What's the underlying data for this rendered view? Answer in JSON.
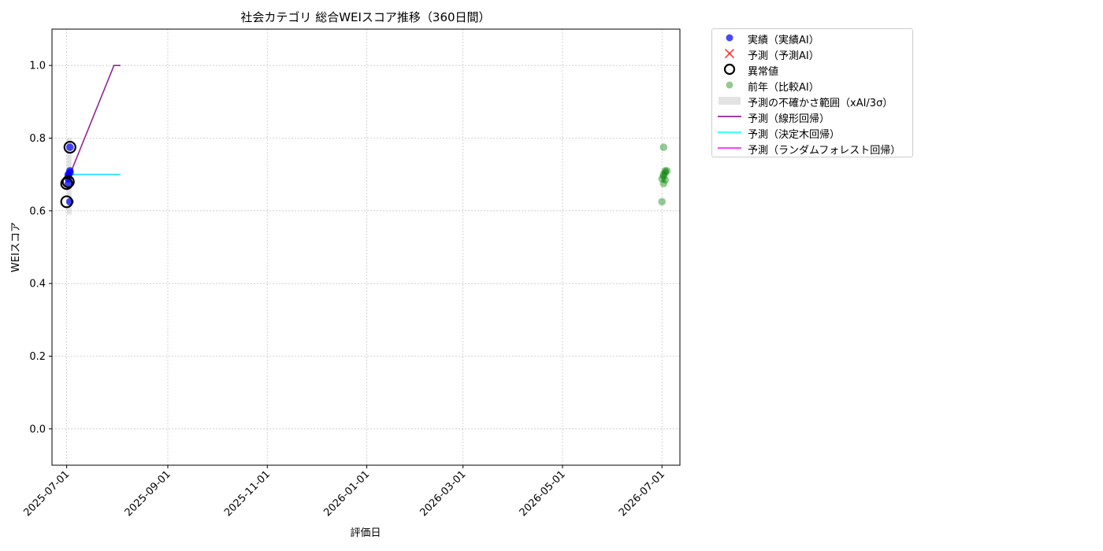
{
  "chart_data": {
    "type": "scatter",
    "title": "社会カテゴリ 総合WEIスコア推移（360日間）",
    "xlabel": "評価日",
    "ylabel": "WEIスコア",
    "x_range": [
      "2025-06-22",
      "2026-07-12"
    ],
    "ylim": [
      -0.1,
      1.1
    ],
    "x_ticks": [
      "2025-07-01",
      "2025-09-01",
      "2025-11-01",
      "2026-01-01",
      "2026-03-01",
      "2026-05-01",
      "2026-07-01"
    ],
    "y_ticks": [
      0.0,
      0.2,
      0.4,
      0.6,
      0.8,
      1.0
    ],
    "y_tick_labels": [
      "0.0",
      "0.2",
      "0.4",
      "0.6",
      "0.8",
      "1.0"
    ],
    "grid": true,
    "legend_position": "outside-top-right",
    "series": [
      {
        "name": "実績（実績AI）",
        "kind": "scatter",
        "color": "#0000ff",
        "points": [
          {
            "x": "2025-07-02",
            "y": 0.675
          },
          {
            "x": "2025-07-02",
            "y": 0.688
          },
          {
            "x": "2025-07-02",
            "y": 0.695
          },
          {
            "x": "2025-07-02",
            "y": 0.7
          },
          {
            "x": "2025-07-03",
            "y": 0.625
          },
          {
            "x": "2025-07-03",
            "y": 0.705
          },
          {
            "x": "2025-07-03",
            "y": 0.71
          },
          {
            "x": "2025-07-03",
            "y": 0.775
          }
        ]
      },
      {
        "name": "予測（予測AI）",
        "kind": "x-marker",
        "color": "#ff0000",
        "points": []
      },
      {
        "name": "異常値",
        "kind": "ring",
        "color": "#000000",
        "points": [
          {
            "x": "2025-07-01",
            "y": 0.625
          },
          {
            "x": "2025-07-01",
            "y": 0.675
          },
          {
            "x": "2025-07-02",
            "y": 0.68
          },
          {
            "x": "2025-07-03",
            "y": 0.775
          }
        ]
      },
      {
        "name": "前年（比較AI）",
        "kind": "scatter",
        "color": "#008000",
        "points": [
          {
            "x": "2026-07-01",
            "y": 0.625
          },
          {
            "x": "2026-07-01",
            "y": 0.688
          },
          {
            "x": "2026-07-02",
            "y": 0.675
          },
          {
            "x": "2026-07-02",
            "y": 0.695
          },
          {
            "x": "2026-07-02",
            "y": 0.7
          },
          {
            "x": "2026-07-02",
            "y": 0.775
          },
          {
            "x": "2026-07-03",
            "y": 0.685
          },
          {
            "x": "2026-07-03",
            "y": 0.705
          },
          {
            "x": "2026-07-03",
            "y": 0.71
          },
          {
            "x": "2026-07-04",
            "y": 0.71
          }
        ]
      },
      {
        "name": "予測の不確かさ範囲（xAI/3σ）",
        "kind": "band",
        "color": "#c0c0c0",
        "points": [
          {
            "x": "2025-07-01",
            "low": 0.59,
            "high": 0.8
          },
          {
            "x": "2025-07-04",
            "low": 0.59,
            "high": 0.8
          }
        ]
      },
      {
        "name": "予測（線形回帰）",
        "kind": "line",
        "color": "#800080",
        "points": [
          {
            "x": "2025-07-03",
            "y": 0.7
          },
          {
            "x": "2025-07-30",
            "y": 1.0
          },
          {
            "x": "2025-08-03",
            "y": 1.0
          }
        ]
      },
      {
        "name": "予測（決定木回帰）",
        "kind": "line",
        "color": "#00ffff",
        "points": [
          {
            "x": "2025-07-03",
            "y": 0.7
          },
          {
            "x": "2025-08-03",
            "y": 0.7
          }
        ]
      },
      {
        "name": "予測（ランダムフォレスト回帰）",
        "kind": "line",
        "color": "#ff00ff",
        "points": [
          {
            "x": "2025-07-03",
            "y": 0.7
          },
          {
            "x": "2025-08-03",
            "y": 0.7
          }
        ]
      }
    ]
  }
}
